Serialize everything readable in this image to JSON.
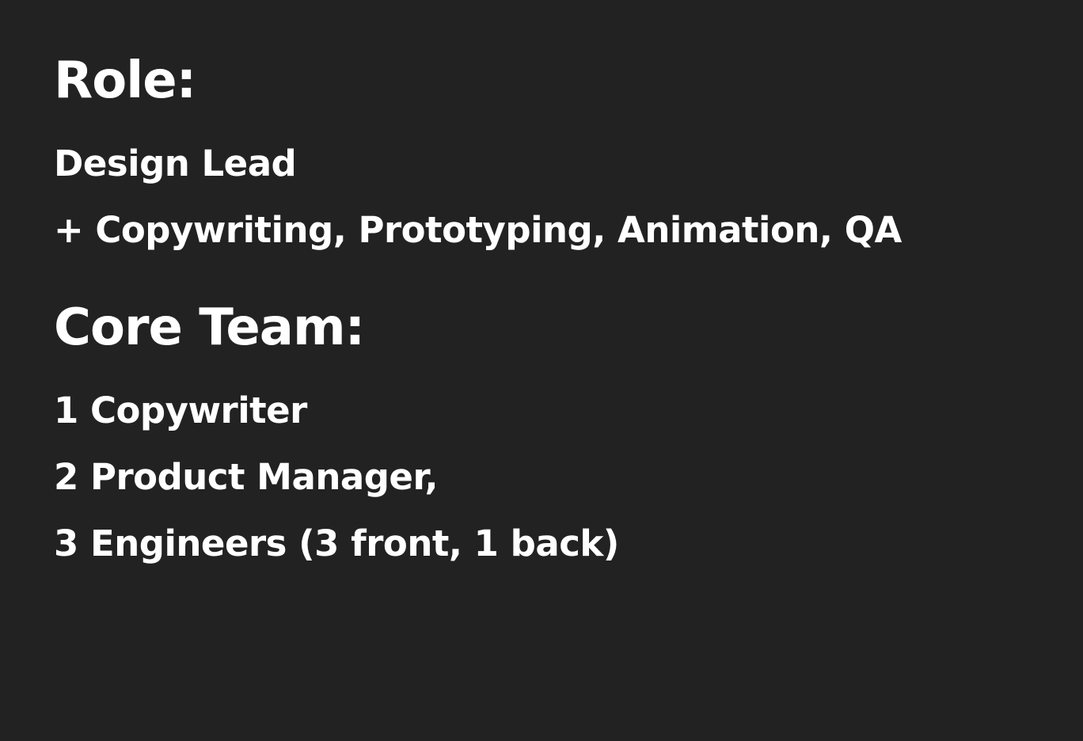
{
  "role": {
    "heading": "Role:",
    "lines": [
      "Design Lead",
      "+ Copywriting, Prototyping, Animation, QA"
    ]
  },
  "team": {
    "heading": "Core Team:",
    "lines": [
      "1 Copywriter",
      "2 Product Manager,",
      "3 Engineers (3 front, 1 back)"
    ]
  },
  "colors": {
    "background": "#222222",
    "text": "#ffffff"
  }
}
